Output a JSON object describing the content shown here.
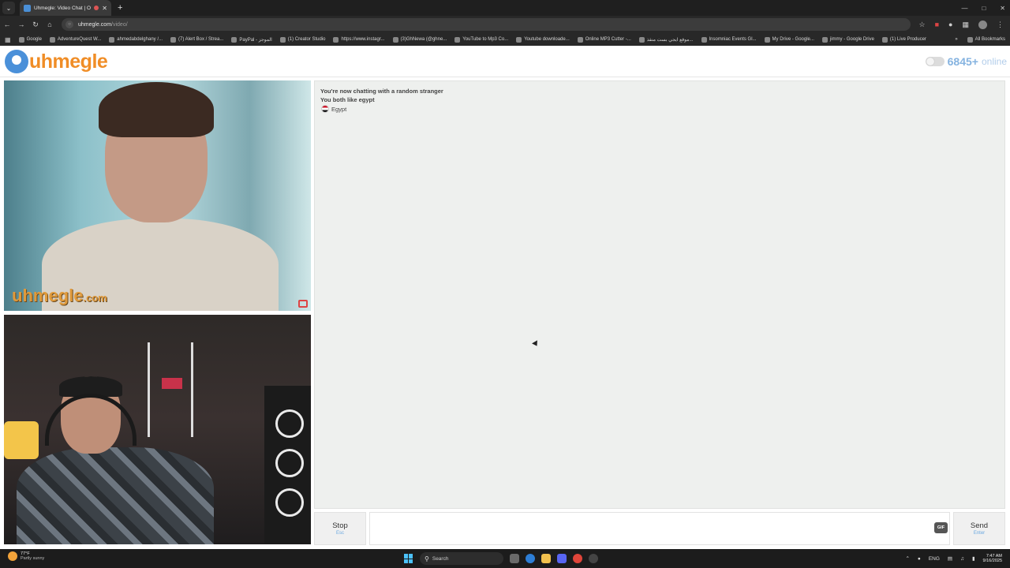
{
  "browser": {
    "tab_title": "Uhmegle: Video Chat | Om",
    "url_host": "uhmegle.com",
    "url_path": "/video/",
    "bookmarks": [
      "Google",
      "AdventureQuest W...",
      "ahmedabdelghany /...",
      "(7) Alert Box / Strea...",
      "PayPal - الموجز",
      "(1) Creator Studio",
      "https://www.instagr...",
      "(3)GhNewa (@ghne...",
      "YouTube to Mp3 Co...",
      "Youtube downloade...",
      "Online MP3 Cutter -...",
      "موقع ايجي بست منقذ...",
      "Insomniac Events Gl...",
      "My Drive - Google...",
      "jimmy - Google Drive",
      "(1) Live Producer"
    ],
    "all_bookmarks": "All Bookmarks"
  },
  "site": {
    "logo_text": "uhmegle",
    "online_count": "6845+",
    "online_label": "online",
    "watermark": "uhmegle",
    "watermark_tld": ".com"
  },
  "chat": {
    "line1": "You're now chatting with a random stranger",
    "line2": "You both like egypt",
    "country": "Egypt",
    "input_value": ""
  },
  "controls": {
    "stop_label": "Stop",
    "stop_hint": "Esc",
    "send_label": "Send",
    "send_hint": "Enter",
    "gif_label": "GIF"
  },
  "taskbar": {
    "temperature": "77°F",
    "weather": "Partly sunny",
    "search_label": "Search",
    "language": "ENG",
    "time": "7:47 AM",
    "date": "9/16/2025"
  },
  "colors": {
    "brand_orange": "#f08d26",
    "brand_blue": "#4a90d9",
    "online_blue": "#85b3e0"
  }
}
